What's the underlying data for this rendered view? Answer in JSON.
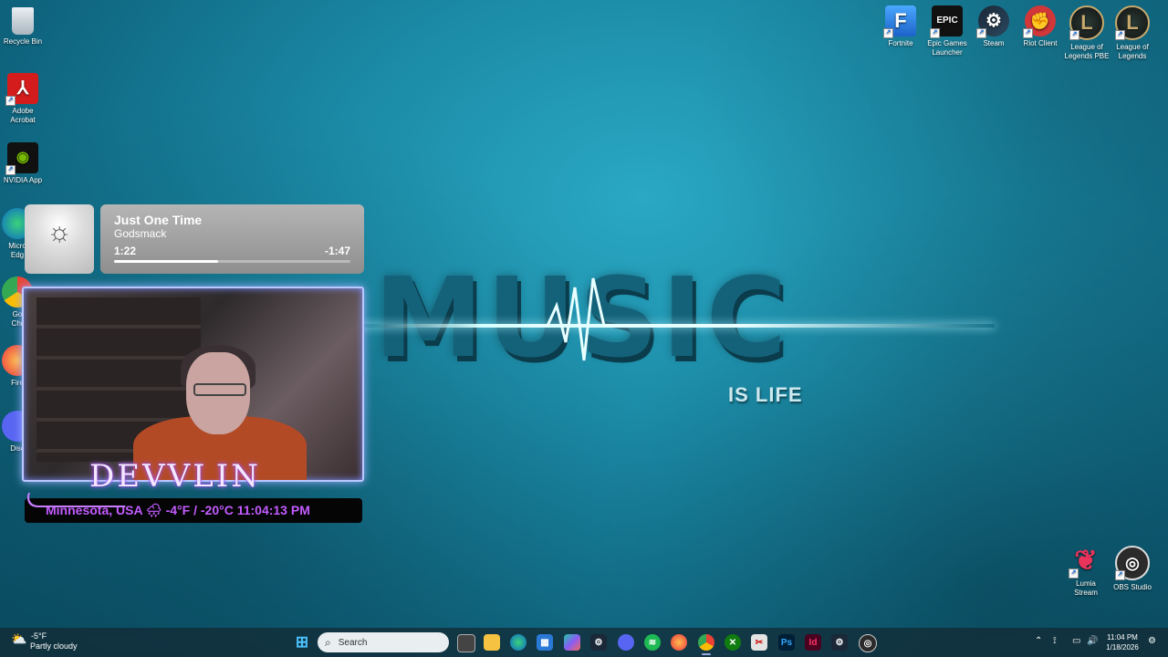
{
  "desktop": {
    "left_icons": [
      {
        "label": "Recycle Bin",
        "icon": "recycle-bin-icon"
      },
      {
        "label": "Adobe\nAcrobat",
        "icon": "acrobat-icon"
      },
      {
        "label": "NVIDIA App",
        "icon": "nvidia-icon"
      },
      {
        "label": "Micro\nEdg",
        "icon": "edge-icon"
      },
      {
        "label": "Go\nChr",
        "icon": "chrome-icon"
      },
      {
        "label": "Fire",
        "icon": "firefox-icon"
      },
      {
        "label": "Disc",
        "icon": "discord-icon"
      }
    ],
    "top_right_icons": [
      {
        "label": "Fortnite",
        "icon": "fortnite-icon",
        "glyph": "F"
      },
      {
        "label": "Epic Games\nLauncher",
        "icon": "epic-games-icon",
        "glyph": "EPIC"
      },
      {
        "label": "Steam",
        "icon": "steam-icon",
        "glyph": "⚙"
      },
      {
        "label": "Riot Client",
        "icon": "riot-icon",
        "glyph": "✊"
      },
      {
        "label": "League of\nLegends PBE",
        "icon": "league-pbe-icon",
        "glyph": "L"
      },
      {
        "label": "League of\nLegends",
        "icon": "league-icon",
        "glyph": "L"
      }
    ],
    "bottom_right_icons": [
      {
        "label": "Lumia\nStream",
        "icon": "lumia-stream-icon"
      },
      {
        "label": "OBS Studio",
        "icon": "obs-icon"
      }
    ]
  },
  "wallpaper": {
    "main_word": "MUSIC",
    "sub_word": "IS LIFE"
  },
  "now_playing": {
    "title": "Just One Time",
    "artist": "Godsmack",
    "elapsed": "1:22",
    "remaining": "-1:47",
    "progress_fraction": 0.44
  },
  "stream_overlay": {
    "name": "DEVVLIN",
    "info": "Minnesota, USA 🌧 -4°F / -20°C  11:04:13 PM"
  },
  "taskbar": {
    "weather_temp": "-5°F",
    "weather_desc": "Partly cloudy",
    "search_placeholder": "Search",
    "time": "11:04 PM",
    "date": "1/18/2026",
    "apps": [
      "start",
      "search",
      "file-explorer",
      "folder",
      "edge",
      "store",
      "copilot",
      "steam",
      "discord",
      "spotify",
      "firefox",
      "chrome",
      "xbox",
      "snipping-tool",
      "photoshop",
      "indesign",
      "steam-2",
      "obs"
    ]
  },
  "colors": {
    "accent_purple": "#c35bff",
    "wallpaper_teal": "#1b8aa6"
  }
}
